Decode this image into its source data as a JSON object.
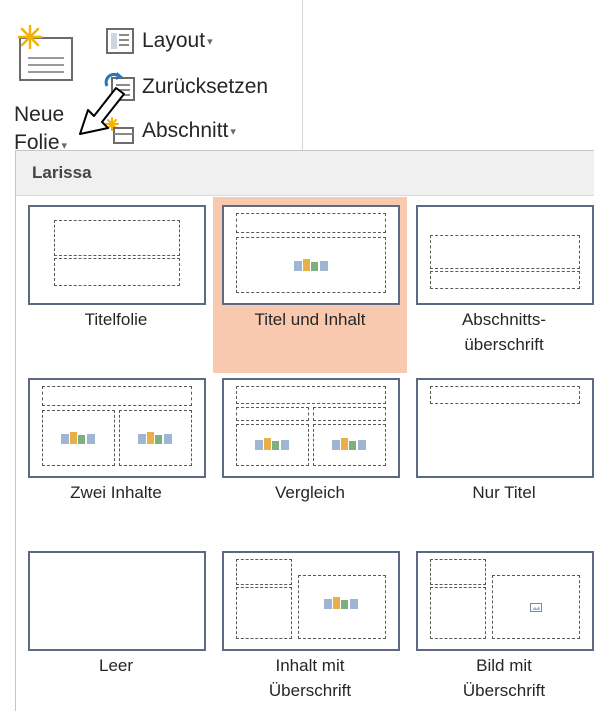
{
  "ribbon": {
    "new_slide": {
      "label_line1": "Neue",
      "label_line2": "Folie",
      "dropdown_glyph": "▾"
    },
    "layout": {
      "label": "Layout",
      "dropdown_glyph": "▾",
      "icon": "layout-icon"
    },
    "reset": {
      "label": "Zurücksetzen",
      "icon": "reset-icon"
    },
    "section": {
      "label": "Abschnitt",
      "dropdown_glyph": "▾",
      "icon": "section-icon"
    }
  },
  "gallery": {
    "theme_name": "Larissa",
    "selected_index": 1,
    "colors": {
      "selected_bg": "#f8c8af",
      "thumb_border": "#5e6a84"
    },
    "layouts": [
      {
        "line1": "Titelfolie",
        "line2": ""
      },
      {
        "line1": "Titel und Inhalt",
        "line2": ""
      },
      {
        "line1": "Abschnitts-",
        "line2": "überschrift"
      },
      {
        "line1": "Zwei Inhalte",
        "line2": ""
      },
      {
        "line1": "Vergleich",
        "line2": ""
      },
      {
        "line1": "Nur Titel",
        "line2": ""
      },
      {
        "line1": "Leer",
        "line2": ""
      },
      {
        "line1": "Inhalt mit",
        "line2": "Überschrift"
      },
      {
        "line1": "Bild mit",
        "line2": "Überschrift"
      }
    ]
  }
}
